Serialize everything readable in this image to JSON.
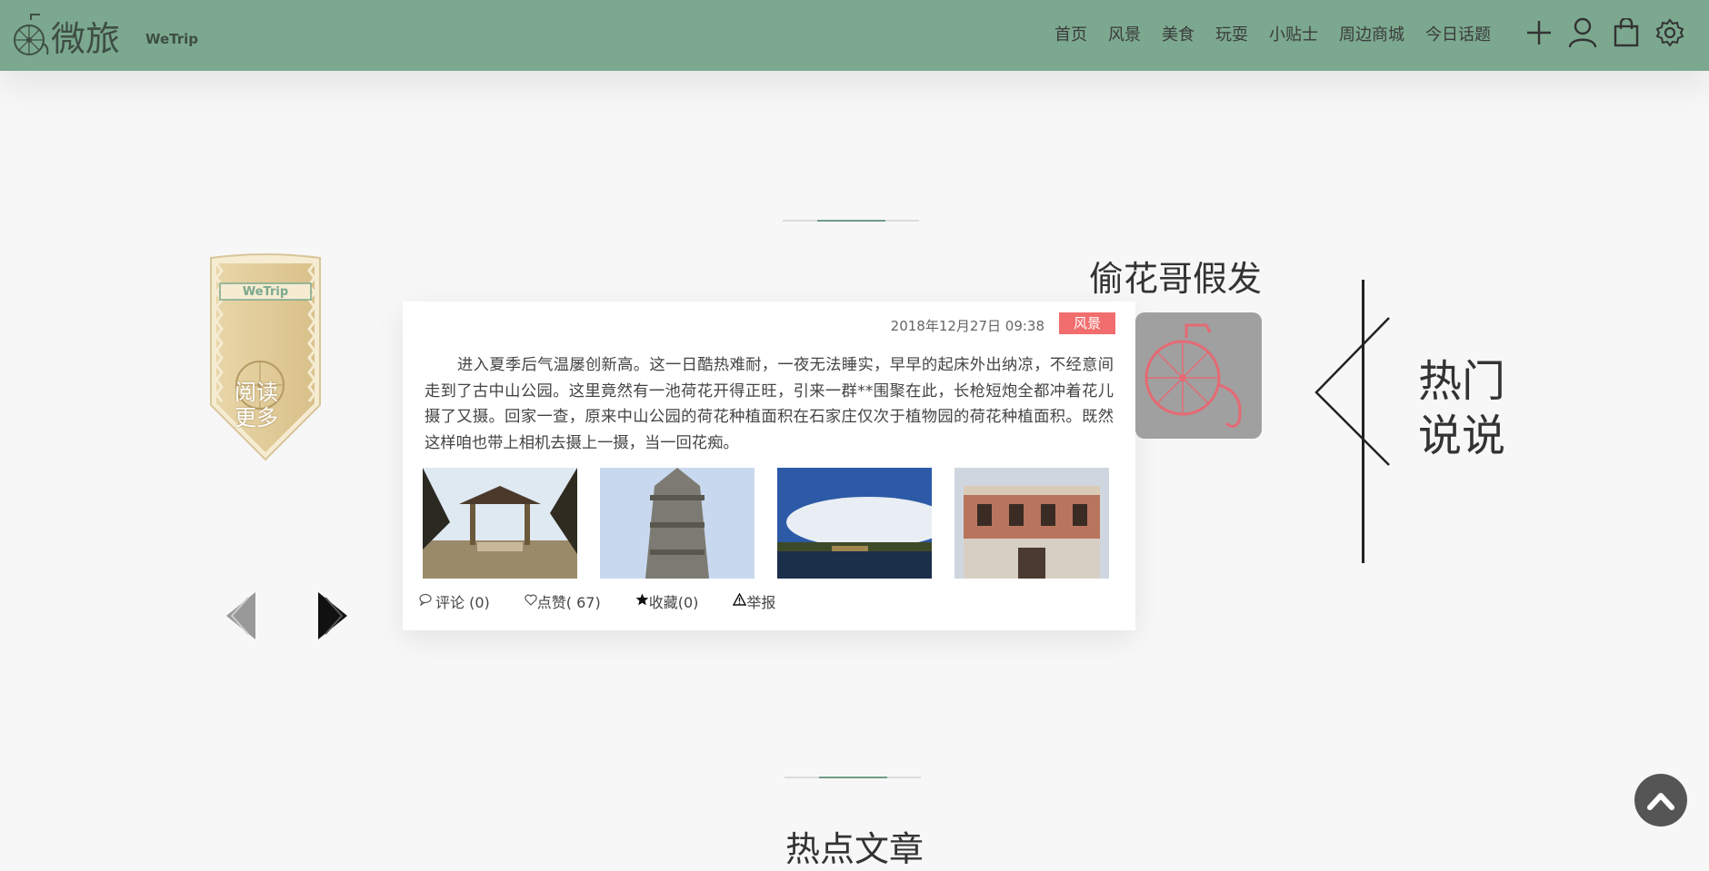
{
  "header": {
    "logo_text_cn": "微旅",
    "logo_text_en": "WeTrip",
    "nav": [
      {
        "label": "首页"
      },
      {
        "label": "风景"
      },
      {
        "label": "美食"
      },
      {
        "label": "玩耍"
      },
      {
        "label": "小贴士"
      },
      {
        "label": "周边商城"
      },
      {
        "label": "今日话题"
      }
    ],
    "icons": [
      "plus-icon",
      "user-icon",
      "shopping-bag-icon",
      "settings-icon"
    ],
    "background_color": "#7ba88e"
  },
  "bookmark": {
    "brand": "WeTrip",
    "read_more_line1": "阅读",
    "read_more_line2": "更多"
  },
  "post": {
    "title": "偷花哥假发",
    "date": "2018年12月27日 09:38",
    "tag": "风景",
    "tag_color": "#f26d6d",
    "text": "进入夏季后气温屡创新高。这一日酷热难耐，一夜无法睡实，早早的起床外出纳凉，不经意间走到了古中山公园。这里竟然有一池荷花开得正旺，引来一群**围聚在此，长枪短炮全都冲着花儿摄了又摄。回家一查，原来中山公园的荷花种植面积在石家庄仅次于植物园的荷花种植面积。既然这样咱也带上相机去摄上一摄，当一回花痴。",
    "images": [
      "pavilion-photo",
      "pagoda-photo",
      "lake-photo",
      "building-photo"
    ],
    "actions": {
      "comment": "评论 (0)",
      "like": "点赞( 67)",
      "favorite": "收藏(0)",
      "report": "举报"
    }
  },
  "hot": {
    "label_line1": "热门",
    "label_line2": "说说"
  },
  "next_section": {
    "title": "热点文章"
  }
}
